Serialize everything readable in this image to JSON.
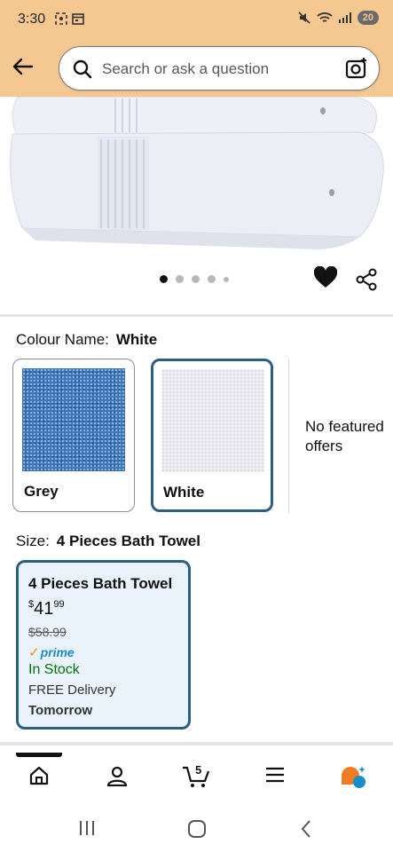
{
  "status_bar": {
    "time": "3:30",
    "battery": "20"
  },
  "search": {
    "placeholder": "Search or ask a question"
  },
  "gallery": {
    "dots": 5,
    "active_index": 0
  },
  "colour": {
    "label": "Colour Name:",
    "selected": "White",
    "options": [
      {
        "label": "Grey",
        "selected": false
      },
      {
        "label": "White",
        "selected": true
      }
    ],
    "no_offers": "No featured offers"
  },
  "size": {
    "label": "Size:",
    "selected": "4 Pieces Bath Towel",
    "card": {
      "title": "4 Pieces Bath Towel",
      "price_symbol": "$",
      "price_whole": "41",
      "price_fraction": "99",
      "list_price": "$58.99",
      "prime": "prime",
      "stock": "In Stock",
      "delivery": "FREE Delivery",
      "delivery_day": "Tomorrow"
    }
  },
  "nav": {
    "cart_count": "5"
  },
  "colors": {
    "header": "#f5c892",
    "selected_border": "#2a5f84",
    "in_stock": "#007600",
    "prime_blue": "#1a8cc8"
  }
}
